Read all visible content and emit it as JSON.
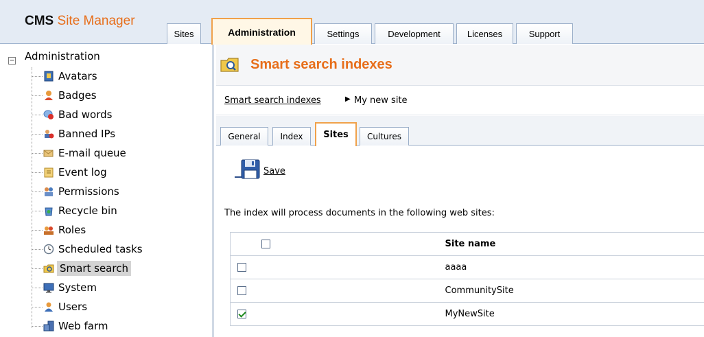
{
  "app": {
    "logo_cms": "CMS",
    "logo_site_manager": "Site Manager",
    "tabs": [
      {
        "label": "Sites",
        "active": false
      },
      {
        "label": "Administration",
        "active": true
      },
      {
        "label": "Settings",
        "active": false
      },
      {
        "label": "Development",
        "active": false
      },
      {
        "label": "Licenses",
        "active": false
      },
      {
        "label": "Support",
        "active": false
      }
    ]
  },
  "tree": {
    "root_label": "Administration",
    "root_toggle": "−",
    "items": [
      {
        "label": "Avatars",
        "icon": "avatar-icon",
        "selected": false
      },
      {
        "label": "Badges",
        "icon": "badge-icon",
        "selected": false
      },
      {
        "label": "Bad words",
        "icon": "bad-words-icon",
        "selected": false
      },
      {
        "label": "Banned IPs",
        "icon": "banned-ip-icon",
        "selected": false
      },
      {
        "label": "E-mail queue",
        "icon": "email-queue-icon",
        "selected": false
      },
      {
        "label": "Event log",
        "icon": "event-log-icon",
        "selected": false
      },
      {
        "label": "Permissions",
        "icon": "permissions-icon",
        "selected": false
      },
      {
        "label": "Recycle bin",
        "icon": "recycle-bin-icon",
        "selected": false
      },
      {
        "label": "Roles",
        "icon": "roles-icon",
        "selected": false
      },
      {
        "label": "Scheduled tasks",
        "icon": "clock-icon",
        "selected": false
      },
      {
        "label": "Smart search",
        "icon": "smart-search-icon",
        "selected": true
      },
      {
        "label": "System",
        "icon": "monitor-icon",
        "selected": false
      },
      {
        "label": "Users",
        "icon": "user-icon",
        "selected": false
      },
      {
        "label": "Web farm",
        "icon": "server-icon",
        "selected": false
      }
    ]
  },
  "main": {
    "title": "Smart search indexes",
    "breadcrumb": {
      "link": "Smart search indexes",
      "separator": "▶",
      "current": "My new site"
    },
    "subtabs": [
      {
        "label": "General",
        "active": false
      },
      {
        "label": "Index",
        "active": false
      },
      {
        "label": "Sites",
        "active": true
      },
      {
        "label": "Cultures",
        "active": false
      }
    ],
    "save_label": "Save",
    "description": "The index will process documents in the following web sites:",
    "table": {
      "header": "Site name",
      "rows": [
        {
          "name": "aaaa",
          "checked": false
        },
        {
          "name": "CommunitySite",
          "checked": false
        },
        {
          "name": "MyNewSite",
          "checked": true
        }
      ]
    }
  },
  "colors": {
    "accent_orange": "#e76e1a",
    "tab_active_border": "#f0a14a",
    "header_bg": "#e4ebf4"
  }
}
